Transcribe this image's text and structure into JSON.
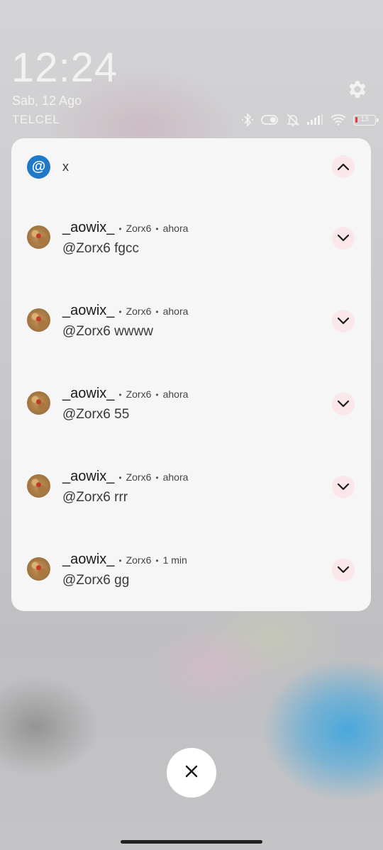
{
  "status_bar": {
    "time": "12:24",
    "date": "Sab, 12 Ago",
    "carrier": "TELCEL",
    "battery_level": "13",
    "icons": [
      "bluetooth-icon",
      "toggle-icon",
      "bell-muted-icon",
      "signal-icon",
      "wifi-icon",
      "battery-icon"
    ]
  },
  "group": {
    "app_icon": "@",
    "app_name": "x"
  },
  "notifications": [
    {
      "user": "_aowix_",
      "account": "Zorx6",
      "time": "ahora",
      "text": "@Zorx6 fgcc"
    },
    {
      "user": "_aowix_",
      "account": "Zorx6",
      "time": "ahora",
      "text": "@Zorx6 wwww"
    },
    {
      "user": "_aowix_",
      "account": "Zorx6",
      "time": "ahora",
      "text": "@Zorx6 55"
    },
    {
      "user": "_aowix_",
      "account": "Zorx6",
      "time": "ahora",
      "text": "@Zorx6 rrr"
    },
    {
      "user": "_aowix_",
      "account": "Zorx6",
      "time": "1 min",
      "text": "@Zorx6 gg"
    }
  ],
  "dot": "•",
  "colors": {
    "app_accent": "#1f78c8",
    "chevron_bg": "#fbe6ea",
    "battery_low": "#e23b3b"
  }
}
